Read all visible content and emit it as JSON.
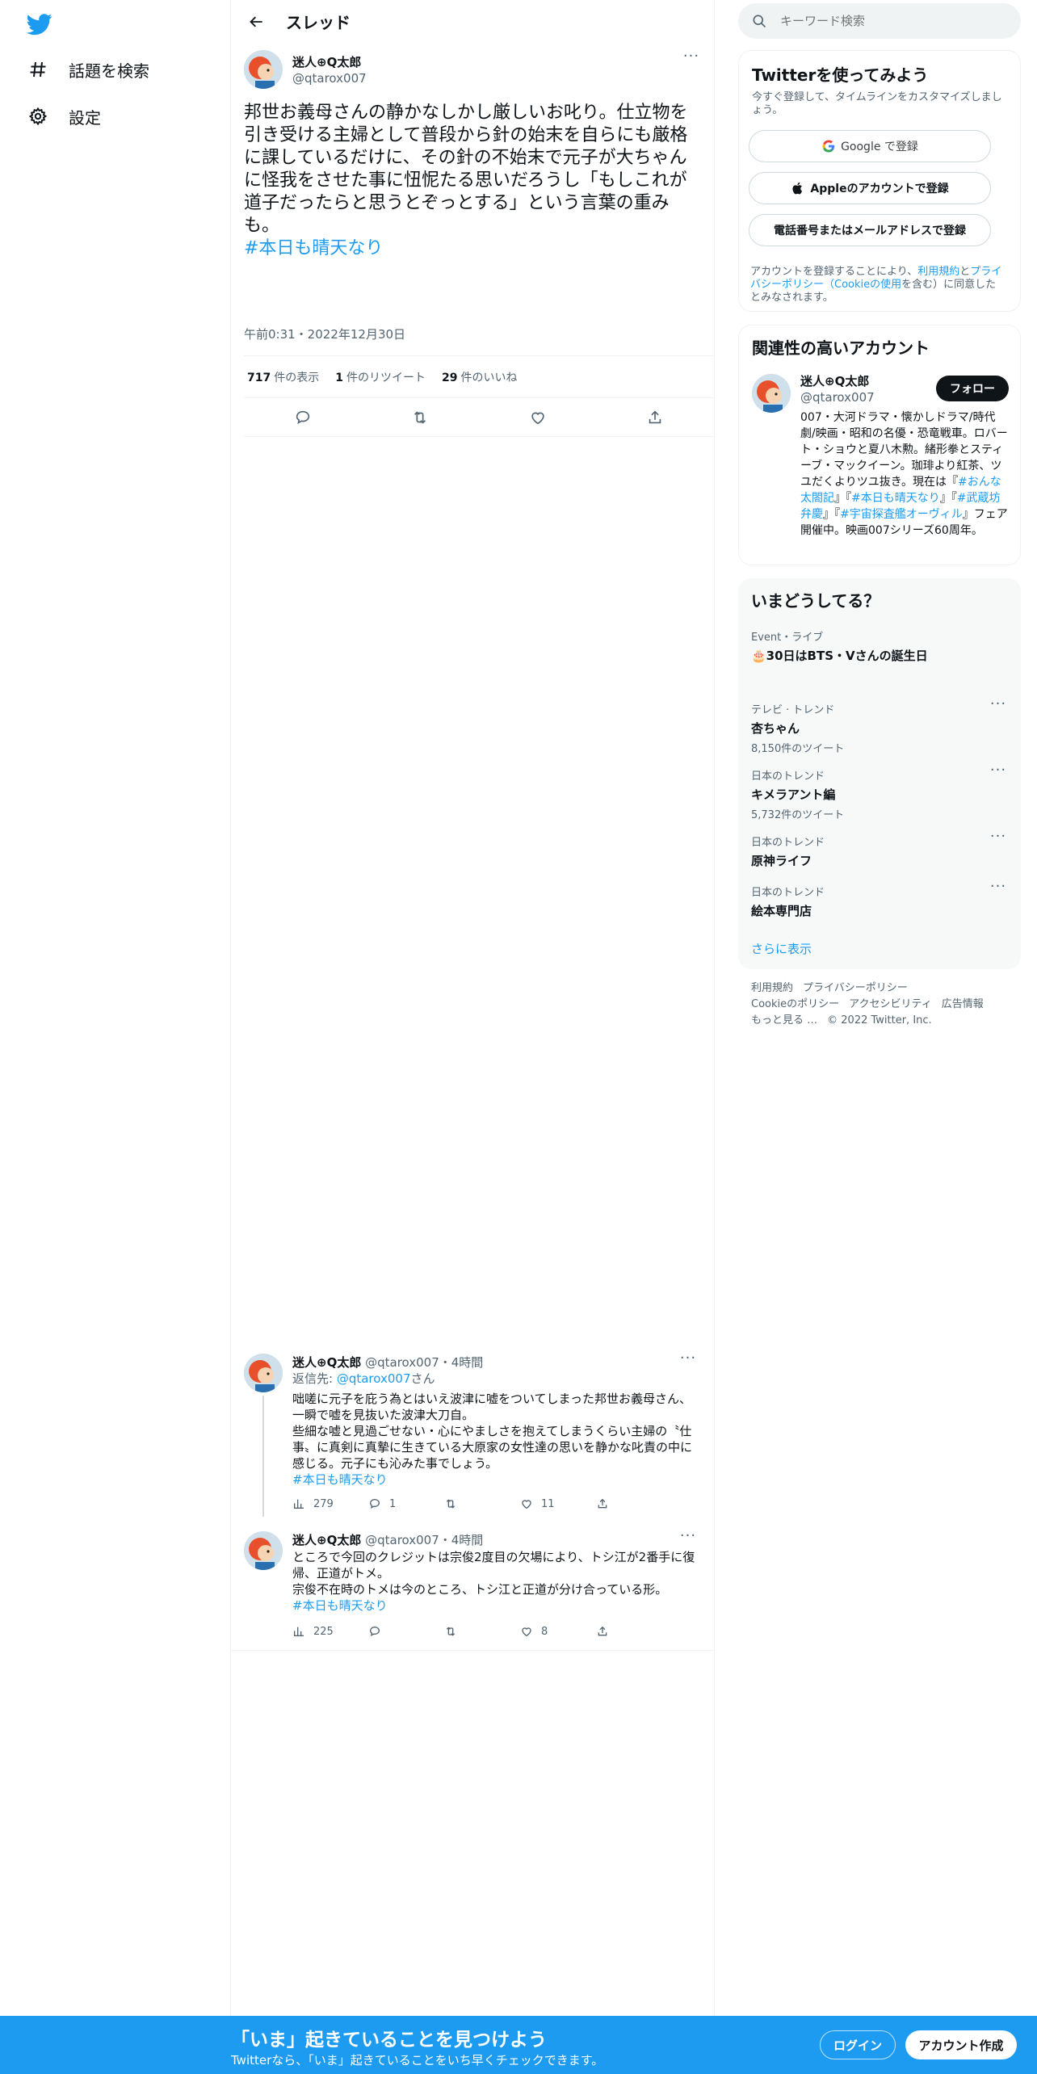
{
  "nav": {
    "logo": "twitter-bird-icon",
    "items": [
      {
        "label": "話題を検索",
        "icon": "hashtag-icon"
      },
      {
        "label": "設定",
        "icon": "gear-icon"
      }
    ]
  },
  "thread": {
    "title": "スレッド",
    "main_tweet": {
      "name": "迷人⊕Q太郎",
      "handle": "@qtarox007",
      "text": "邦世お義母さんの静かなしかし厳しいお叱り。仕立物を引き受ける主婦として普段から針の始末を自らにも厳格に課しているだけに、その針の不始末で元子が大ちゃんに怪我をさせた事に忸怩たる思いだろうし「もしこれが道子だったらと思うとぞっとする」という言葉の重みも。",
      "hashtag": "#本日も晴天なり",
      "date": "午前0:31・2022年12月30日",
      "stats": {
        "views": "717",
        "views_label": "件の表示",
        "retweets": "1",
        "retweets_label": "件のリツイート",
        "likes": "29",
        "likes_label": "件のいいね"
      }
    },
    "replies": [
      {
        "name": "迷人⊕Q太郎",
        "handle": "@qtarox007",
        "time": "・4時間",
        "reply_to_prefix": "返信先: ",
        "reply_to_mention": "@qtarox007",
        "reply_to_suffix": "さん",
        "text": "咄嗟に元子を庇う為とはいえ波津に嘘をついてしまった邦世お義母さん、一瞬で嘘を見抜いた波津大刀自。\n些細な嘘と見過ごせない・心にやましさを抱えてしまうくらい主婦の〝仕事〟に真剣に真摯に生きている大原家の女性達の思いを静かな叱責の中に感じる。元子にも沁みた事でしょう。",
        "hashtag": "#本日も晴天なり",
        "views": "279",
        "replies": "1",
        "retweets": "",
        "likes": "11"
      },
      {
        "name": "迷人⊕Q太郎",
        "handle": "@qtarox007",
        "time": "・4時間",
        "text": "ところで今回のクレジットは宗俊2度目の欠場により、トシ江が2番手に復帰、正道がトメ。\n宗俊不在時のトメは今のところ、トシ江と正道が分け合っている形。",
        "hashtag": "#本日も晴天なり",
        "views": "225",
        "replies": "",
        "retweets": "",
        "likes": "8"
      }
    ]
  },
  "search": {
    "placeholder": "キーワード検索"
  },
  "signup": {
    "title": "Twitterを使ってみよう",
    "subtitle": "今すぐ登録して、タイムラインをカスタマイズしましょう。",
    "google_label": "Google で登録",
    "apple_label": "Appleのアカウントで登録",
    "phone_label": "電話番号またはメールアドレスで登録",
    "terms_prefix": "アカウントを登録することにより、",
    "terms_link1": "利用規約",
    "terms_mid1": "と",
    "terms_link2": "プライバシーポリシー（Cookieの使用",
    "terms_mid2": "を含む）に同意したとみなされます。"
  },
  "related": {
    "title": "関連性の高いアカウント",
    "name": "迷人⊕Q太郎",
    "handle": "@qtarox007",
    "follow_label": "フォロー",
    "bio_1": "007・大河ドラマ・懐かしドラマ/時代劇/映画・昭和の名優・恐竜戦車。ロバート・ショウと夏八木勲。緒形拳とスティーブ・マックイーン。珈琲より紅茶、ツユだくよりツユ抜き。現在は『",
    "bio_ht1": "#おんな太閤記",
    "bio_2": "』『",
    "bio_ht2": "#本日も晴天なり",
    "bio_3": "』『",
    "bio_ht3": "#武蔵坊弁慶",
    "bio_4": "』『",
    "bio_ht4": "#宇宙探査艦オーヴィル",
    "bio_5": "』フェア開催中。映画007シリーズ60周年。"
  },
  "trends": {
    "title": "いまどうしてる？",
    "items": [
      {
        "context": "Event・ライブ",
        "name": "🎂30日はBTS・Vさんの誕生日",
        "count": ""
      },
      {
        "context": "テレビ · トレンド",
        "name": "杏ちゃん",
        "count": "8,150件のツイート"
      },
      {
        "context": "日本のトレンド",
        "name": "キメラアント編",
        "count": "5,732件のツイート"
      },
      {
        "context": "日本のトレンド",
        "name": "原神ライフ",
        "count": ""
      },
      {
        "context": "日本のトレンド",
        "name": "絵本専門店",
        "count": ""
      }
    ],
    "show_more": "さらに表示"
  },
  "footer": {
    "links": [
      "利用規約",
      "プライバシーポリシー",
      "Cookieのポリシー",
      "アクセシビリティ",
      "広告情報",
      "もっと見る …",
      "© 2022 Twitter, Inc."
    ]
  },
  "bottom_bar": {
    "title": "「いま」起きていることを見つけよう",
    "subtitle": "Twitterなら、「いま」起きていることをいち早くチェックできます。",
    "login_label": "ログイン",
    "signup_label": "アカウント作成"
  },
  "colors": {
    "accent": "#1d9bf0",
    "text": "#0f1419",
    "muted": "#536471",
    "border": "#eff3f4"
  }
}
